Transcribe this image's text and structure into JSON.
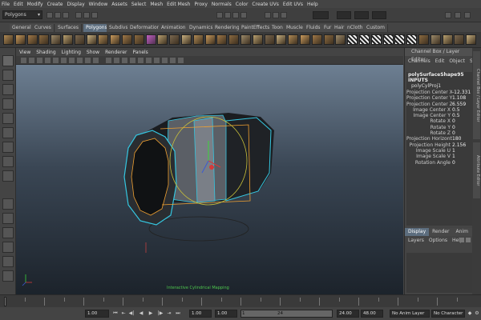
{
  "menu": [
    "File",
    "Edit",
    "Modify",
    "Create",
    "Display",
    "Window",
    "Assets",
    "Select",
    "Mesh",
    "Edit Mesh",
    "Proxy",
    "Normals",
    "Color",
    "Create UVs",
    "Edit UVs",
    "Help"
  ],
  "status": {
    "mode": "Polygons"
  },
  "shelf_tabs": [
    "General",
    "Curves",
    "Surfaces",
    "Polygons",
    "Subdivs",
    "Deformation",
    "Animation",
    "Dynamics",
    "Rendering",
    "PaintEffects",
    "Toon",
    "Muscle",
    "Fluids",
    "Fur",
    "Hair",
    "nCloth",
    "Custom"
  ],
  "active_shelf": "Polygons",
  "panel_menu": [
    "View",
    "Shading",
    "Lighting",
    "Show",
    "Renderer",
    "Panels"
  ],
  "viewport": {
    "hud_text": "Interactive Cylindrical Mapping"
  },
  "right_strip": {
    "tab1": "Channel Box / Layer Editor",
    "tab2": "Attribute Editor"
  },
  "channel_box": {
    "title": "Channel Box / Layer Editor",
    "menu": [
      "Channels",
      "Edit",
      "Object",
      "Show"
    ],
    "node": "polySurfaceShape95",
    "inputs_label": "INPUTS",
    "input_node": "polyCylProj1",
    "attrs": [
      {
        "label": "Projection Center X",
        "value": "-12.331"
      },
      {
        "label": "Projection Center Y",
        "value": "1.108"
      },
      {
        "label": "Projection Center Z",
        "value": "6.559"
      },
      {
        "label": "Image Center X",
        "value": "0.5"
      },
      {
        "label": "Image Center Y",
        "value": "0.5"
      },
      {
        "label": "Rotate X",
        "value": "0"
      },
      {
        "label": "Rotate Y",
        "value": "0"
      },
      {
        "label": "Rotate Z",
        "value": "0"
      },
      {
        "label": "Projection Horizontal Sw...",
        "value": "180"
      },
      {
        "label": "Projection Height",
        "value": "2.156"
      },
      {
        "label": "Image Scale U",
        "value": "1"
      },
      {
        "label": "Image Scale V",
        "value": "1"
      },
      {
        "label": "Rotation Angle",
        "value": "0"
      }
    ]
  },
  "layer_editor": {
    "tabs": [
      "Display",
      "Render",
      "Anim"
    ],
    "active": "Display",
    "menu": [
      "Layers",
      "Options",
      "Help"
    ]
  },
  "timeline": {
    "start": "1.00",
    "current": "1.00",
    "range_start": "1.00",
    "slider_left": "1",
    "slider_right": "24",
    "range_end": "24.00",
    "end": "48.00",
    "anim_layer": "No Anim Layer",
    "char_set": "No Character Set"
  },
  "colors": {
    "accent": "#5c6d7e",
    "wire_cyan": "#35c6e0",
    "wire_orange": "#f0a030"
  }
}
